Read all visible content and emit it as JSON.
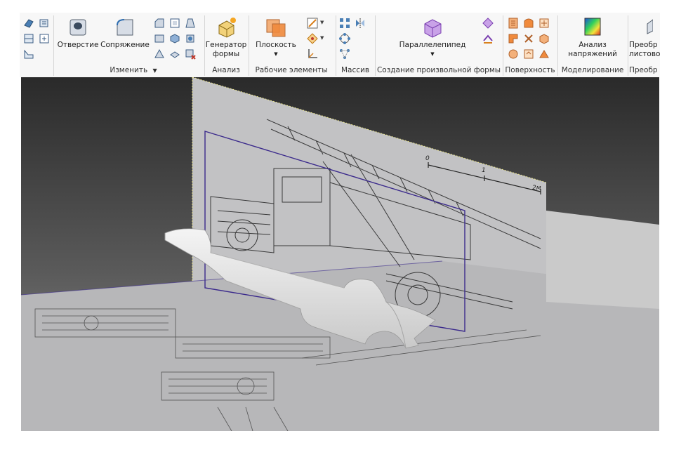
{
  "ribbon": {
    "modify_panel": {
      "title": "Изменить",
      "hole_label": "Отверстие",
      "fillet_label": "Сопряжение"
    },
    "analysis_panel": {
      "title": "Анализ",
      "shape_generator_label": "Генератор формы"
    },
    "work_features_panel": {
      "title": "Рабочие элементы",
      "plane_label": "Плоскость"
    },
    "pattern_panel": {
      "title": "Массив"
    },
    "freeform_panel": {
      "title": "Создание произвольной формы",
      "box_label": "Параллелепипед"
    },
    "surface_panel": {
      "title": "Поверхность"
    },
    "simulation_panel": {
      "title": "Моделирование",
      "stress_analysis_label": "Анализ напряжений"
    },
    "sheetmetal_panel": {
      "title": "Преобр",
      "label_partial": "Преобр листово"
    }
  },
  "viewport": {
    "scale_bar": {
      "tick_0": "0",
      "tick_1": "1",
      "tick_2": "2м"
    }
  },
  "colors": {
    "ribbon_bg": "#f7f7f7",
    "viewport_dark": "#2a2a2a",
    "viewport_light": "#8e8e8e",
    "sketch_plane": "#c2c2c4",
    "sketch_outline": "#3b2a8c",
    "model_body": "#e9e9e9"
  }
}
